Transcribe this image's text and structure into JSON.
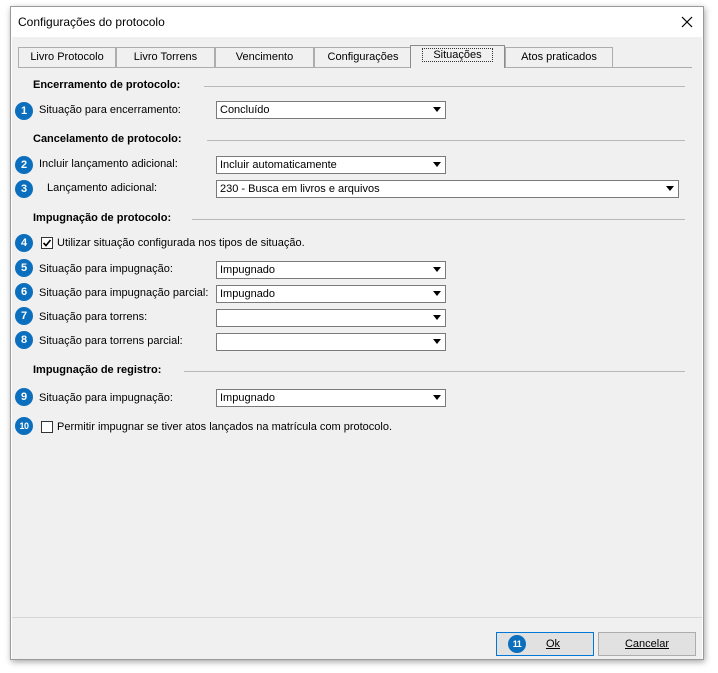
{
  "window": {
    "title": "Configurações do protocolo"
  },
  "tabs": [
    {
      "label": "Livro Protocolo"
    },
    {
      "label": "Livro Torrens"
    },
    {
      "label": "Vencimento"
    },
    {
      "label": "Configurações"
    },
    {
      "label": "Situações"
    },
    {
      "label": "Atos praticados"
    }
  ],
  "active_tab": "Situações",
  "sections": {
    "encerramento": "Encerramento de protocolo:",
    "cancelamento": "Cancelamento de protocolo:",
    "impugnacao_protocolo": "Impugnação de protocolo:",
    "impugnacao_registro": "Impugnação de registro:"
  },
  "fields": {
    "situacao_encerramento": {
      "badge": "1",
      "label": "Situação para encerramento:",
      "value": "Concluído"
    },
    "incluir_lancamento": {
      "badge": "2",
      "label": "Incluir lançamento adicional:",
      "value": "Incluir automaticamente"
    },
    "lancamento_adicional": {
      "badge": "3",
      "label": "Lançamento adicional:",
      "value": "230 - Busca em livros e arquivos"
    },
    "utilizar_situacao": {
      "badge": "4",
      "label": "Utilizar situação configurada nos tipos de situação.",
      "checked": true
    },
    "situacao_impugnacao": {
      "badge": "5",
      "label": "Situação para impugnação:",
      "value": "Impugnado"
    },
    "situacao_impugnacao_parcial": {
      "badge": "6",
      "label": "Situação para impugnação parcial:",
      "value": "Impugnado"
    },
    "situacao_torrens": {
      "badge": "7",
      "label": "Situação para torrens:",
      "value": ""
    },
    "situacao_torrens_parcial": {
      "badge": "8",
      "label": "Situação para torrens parcial:",
      "value": ""
    },
    "situacao_impugnacao_registro": {
      "badge": "9",
      "label": "Situação para impugnação:",
      "value": "Impugnado"
    },
    "permitir_impugnar": {
      "badge": "10",
      "label": "Permitir impugnar se tiver atos lançados na matrícula com protocolo.",
      "checked": false
    }
  },
  "buttons": {
    "ok": {
      "badge": "11",
      "label": "Ok"
    },
    "cancel": {
      "label": "Cancelar"
    }
  },
  "colors": {
    "badge": "#0b6fbd",
    "dialog_bg": "#f0f0f0",
    "default_button_border": "#0078d7"
  },
  "icons": {
    "close": "close-icon",
    "dropdown": "chevron-down-icon",
    "check": "check-icon"
  }
}
